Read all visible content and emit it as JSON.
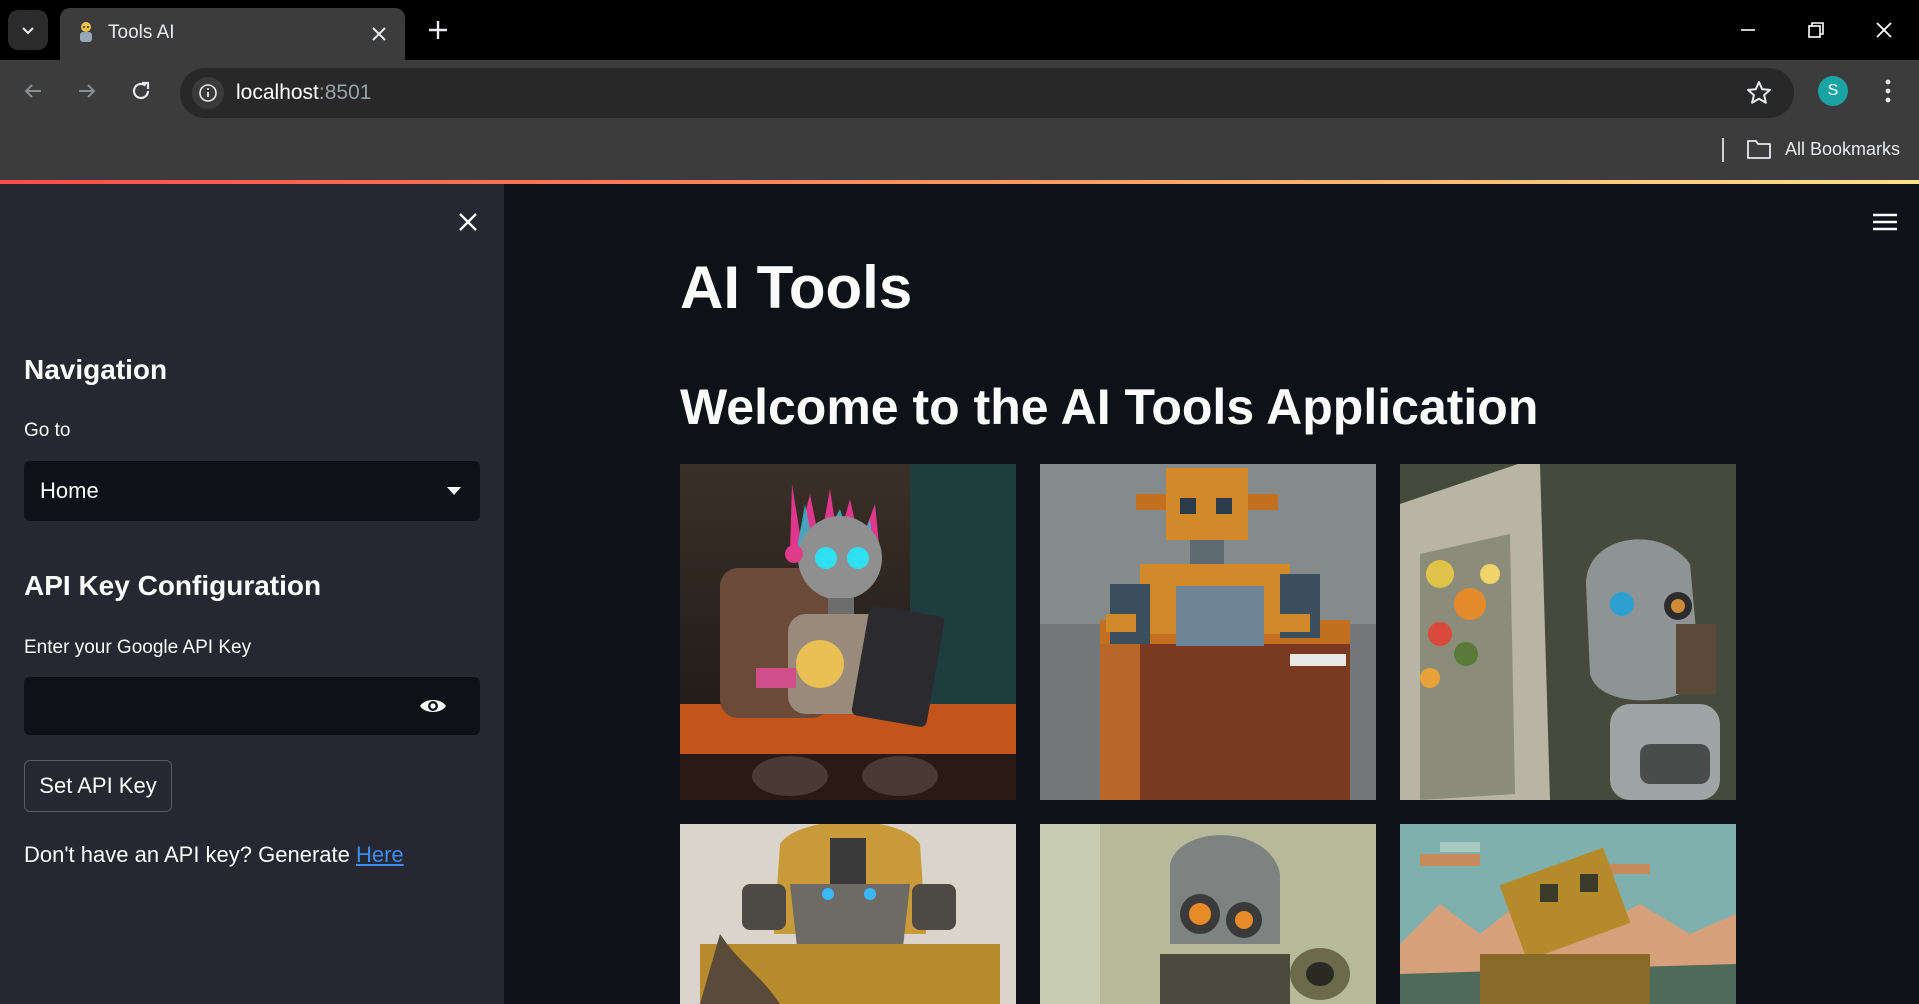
{
  "browser": {
    "tab_title": "Tools AI",
    "url_host": "localhost",
    "url_port": ":8501",
    "profile_initial": "S",
    "bookmarks_label": "All Bookmarks"
  },
  "sidebar": {
    "nav_heading": "Navigation",
    "goto_label": "Go to",
    "selected_page": "Home",
    "api_heading": "API Key Configuration",
    "api_input_label": "Enter your Google API Key",
    "set_button_label": "Set API Key",
    "help_text": "Don't have an API key? Generate ",
    "help_link_text": "Here"
  },
  "main": {
    "title": "AI Tools",
    "subtitle": "Welcome to the AI Tools Application",
    "gallery": [
      {
        "name": "robot-tablet-image"
      },
      {
        "name": "pixel-robot-laptop-image"
      },
      {
        "name": "robot-painter-image"
      },
      {
        "name": "armored-robot-image"
      },
      {
        "name": "goggles-robot-image"
      },
      {
        "name": "pixel-landscape-robot-image"
      }
    ]
  },
  "colors": {
    "app_bg": "#0e1117",
    "sidebar_bg": "#262730",
    "link": "#3a8df5",
    "accent": "#ff4b4b"
  }
}
